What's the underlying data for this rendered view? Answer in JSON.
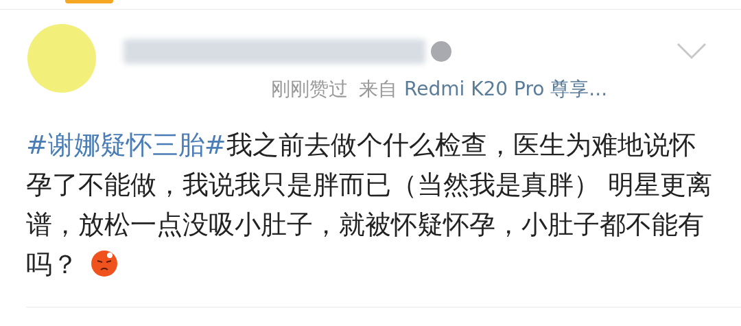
{
  "post": {
    "meta": {
      "liked": "刚刚赞过",
      "source_prefix": "来自",
      "device": "Redmi K20 Pro 尊享..."
    },
    "body": {
      "hashtag": "#谢娜疑怀三胎#",
      "text": "我之前去做个什么检查，医生为难地说怀孕了不能做，我说我只是胖而已（当然我是真胖） 明星更离谱，放松一点没吸小肚子，就被怀疑怀孕，小肚子都不能有吗？"
    }
  }
}
